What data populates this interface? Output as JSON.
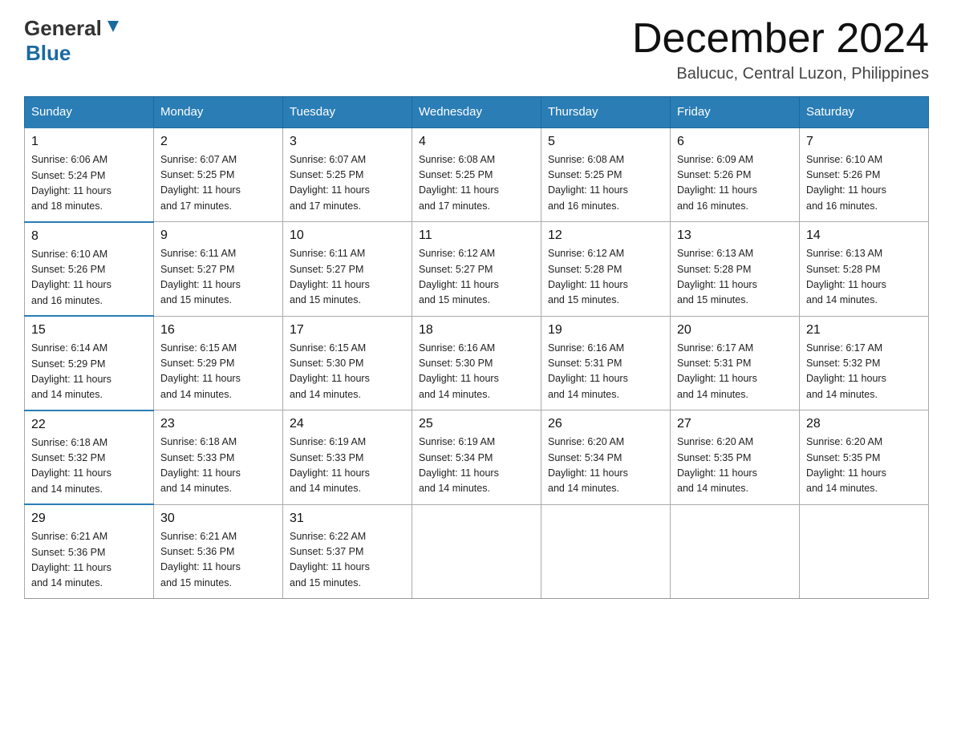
{
  "header": {
    "logo_general": "General",
    "logo_blue": "Blue",
    "month_year": "December 2024",
    "location": "Balucuc, Central Luzon, Philippines"
  },
  "weekdays": [
    "Sunday",
    "Monday",
    "Tuesday",
    "Wednesday",
    "Thursday",
    "Friday",
    "Saturday"
  ],
  "weeks": [
    [
      {
        "day": "1",
        "sunrise": "6:06 AM",
        "sunset": "5:24 PM",
        "daylight": "11 hours and 18 minutes."
      },
      {
        "day": "2",
        "sunrise": "6:07 AM",
        "sunset": "5:25 PM",
        "daylight": "11 hours and 17 minutes."
      },
      {
        "day": "3",
        "sunrise": "6:07 AM",
        "sunset": "5:25 PM",
        "daylight": "11 hours and 17 minutes."
      },
      {
        "day": "4",
        "sunrise": "6:08 AM",
        "sunset": "5:25 PM",
        "daylight": "11 hours and 17 minutes."
      },
      {
        "day": "5",
        "sunrise": "6:08 AM",
        "sunset": "5:25 PM",
        "daylight": "11 hours and 16 minutes."
      },
      {
        "day": "6",
        "sunrise": "6:09 AM",
        "sunset": "5:26 PM",
        "daylight": "11 hours and 16 minutes."
      },
      {
        "day": "7",
        "sunrise": "6:10 AM",
        "sunset": "5:26 PM",
        "daylight": "11 hours and 16 minutes."
      }
    ],
    [
      {
        "day": "8",
        "sunrise": "6:10 AM",
        "sunset": "5:26 PM",
        "daylight": "11 hours and 16 minutes."
      },
      {
        "day": "9",
        "sunrise": "6:11 AM",
        "sunset": "5:27 PM",
        "daylight": "11 hours and 15 minutes."
      },
      {
        "day": "10",
        "sunrise": "6:11 AM",
        "sunset": "5:27 PM",
        "daylight": "11 hours and 15 minutes."
      },
      {
        "day": "11",
        "sunrise": "6:12 AM",
        "sunset": "5:27 PM",
        "daylight": "11 hours and 15 minutes."
      },
      {
        "day": "12",
        "sunrise": "6:12 AM",
        "sunset": "5:28 PM",
        "daylight": "11 hours and 15 minutes."
      },
      {
        "day": "13",
        "sunrise": "6:13 AM",
        "sunset": "5:28 PM",
        "daylight": "11 hours and 15 minutes."
      },
      {
        "day": "14",
        "sunrise": "6:13 AM",
        "sunset": "5:28 PM",
        "daylight": "11 hours and 14 minutes."
      }
    ],
    [
      {
        "day": "15",
        "sunrise": "6:14 AM",
        "sunset": "5:29 PM",
        "daylight": "11 hours and 14 minutes."
      },
      {
        "day": "16",
        "sunrise": "6:15 AM",
        "sunset": "5:29 PM",
        "daylight": "11 hours and 14 minutes."
      },
      {
        "day": "17",
        "sunrise": "6:15 AM",
        "sunset": "5:30 PM",
        "daylight": "11 hours and 14 minutes."
      },
      {
        "day": "18",
        "sunrise": "6:16 AM",
        "sunset": "5:30 PM",
        "daylight": "11 hours and 14 minutes."
      },
      {
        "day": "19",
        "sunrise": "6:16 AM",
        "sunset": "5:31 PM",
        "daylight": "11 hours and 14 minutes."
      },
      {
        "day": "20",
        "sunrise": "6:17 AM",
        "sunset": "5:31 PM",
        "daylight": "11 hours and 14 minutes."
      },
      {
        "day": "21",
        "sunrise": "6:17 AM",
        "sunset": "5:32 PM",
        "daylight": "11 hours and 14 minutes."
      }
    ],
    [
      {
        "day": "22",
        "sunrise": "6:18 AM",
        "sunset": "5:32 PM",
        "daylight": "11 hours and 14 minutes."
      },
      {
        "day": "23",
        "sunrise": "6:18 AM",
        "sunset": "5:33 PM",
        "daylight": "11 hours and 14 minutes."
      },
      {
        "day": "24",
        "sunrise": "6:19 AM",
        "sunset": "5:33 PM",
        "daylight": "11 hours and 14 minutes."
      },
      {
        "day": "25",
        "sunrise": "6:19 AM",
        "sunset": "5:34 PM",
        "daylight": "11 hours and 14 minutes."
      },
      {
        "day": "26",
        "sunrise": "6:20 AM",
        "sunset": "5:34 PM",
        "daylight": "11 hours and 14 minutes."
      },
      {
        "day": "27",
        "sunrise": "6:20 AM",
        "sunset": "5:35 PM",
        "daylight": "11 hours and 14 minutes."
      },
      {
        "day": "28",
        "sunrise": "6:20 AM",
        "sunset": "5:35 PM",
        "daylight": "11 hours and 14 minutes."
      }
    ],
    [
      {
        "day": "29",
        "sunrise": "6:21 AM",
        "sunset": "5:36 PM",
        "daylight": "11 hours and 14 minutes."
      },
      {
        "day": "30",
        "sunrise": "6:21 AM",
        "sunset": "5:36 PM",
        "daylight": "11 hours and 15 minutes."
      },
      {
        "day": "31",
        "sunrise": "6:22 AM",
        "sunset": "5:37 PM",
        "daylight": "11 hours and 15 minutes."
      },
      null,
      null,
      null,
      null
    ]
  ],
  "labels": {
    "sunrise": "Sunrise:",
    "sunset": "Sunset:",
    "daylight": "Daylight:"
  }
}
